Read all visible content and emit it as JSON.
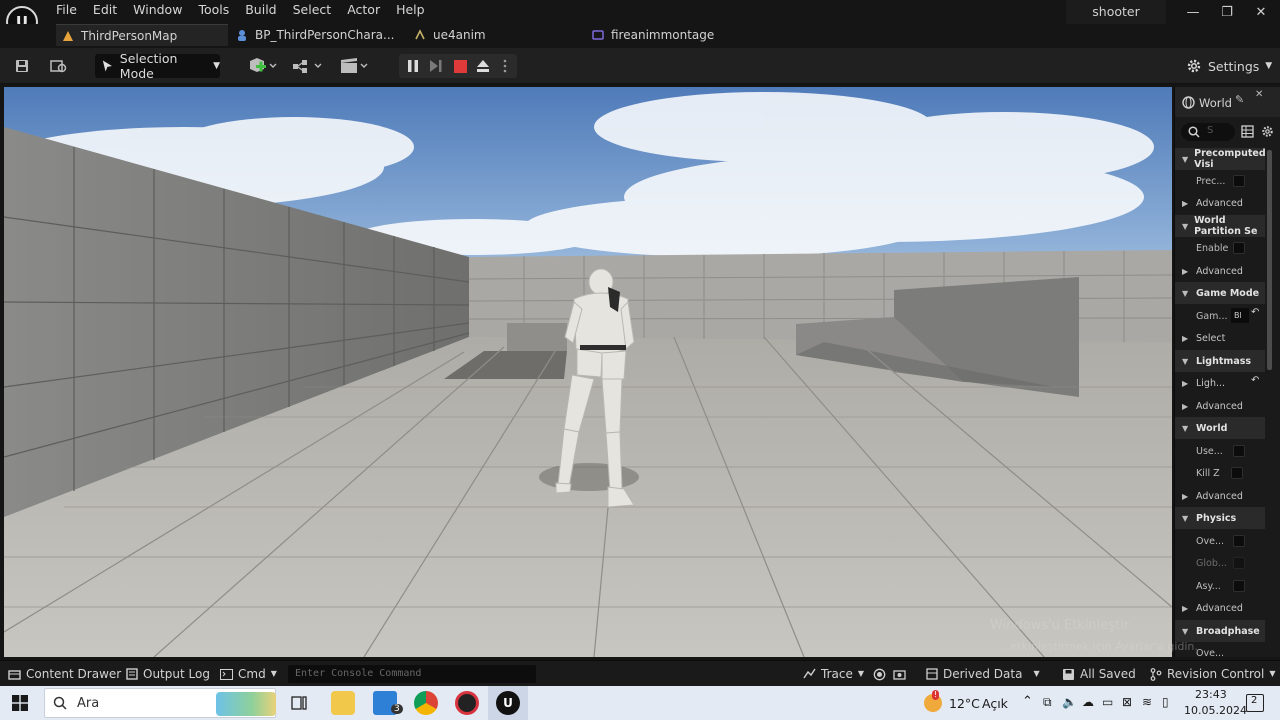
{
  "app": {
    "logo_letter": "U",
    "menu": [
      "File",
      "Edit",
      "Window",
      "Tools",
      "Build",
      "Select",
      "Actor",
      "Help"
    ],
    "project_name": "shooter",
    "window_controls": {
      "minimize": "—",
      "maximize": "❐",
      "close": "✕"
    }
  },
  "tabs": [
    {
      "label": "ThirdPersonMap",
      "active": true
    },
    {
      "label": "BP_ThirdPersonChara...",
      "active": false
    },
    {
      "label": "ue4anim",
      "active": false
    },
    {
      "label": "fireanimmontage",
      "active": false
    }
  ],
  "toolbar": {
    "mode_label": "Selection Mode",
    "settings_label": "Settings"
  },
  "details": {
    "tab_title": "World",
    "search_placeholder": "S",
    "rows": [
      {
        "kind": "header",
        "label": "Precomputed Visi"
      },
      {
        "kind": "prop",
        "label": "Prec..."
      },
      {
        "kind": "collapsed",
        "label": "Advanced"
      },
      {
        "kind": "header",
        "label": "World Partition Se"
      },
      {
        "kind": "prop",
        "label": "Enable"
      },
      {
        "kind": "collapsed",
        "label": "Advanced"
      },
      {
        "kind": "header",
        "label": "Game Mode"
      },
      {
        "kind": "prop",
        "label": "Gam...",
        "value": "Bl"
      },
      {
        "kind": "collapsed",
        "label": "Select"
      },
      {
        "kind": "header",
        "label": "Lightmass"
      },
      {
        "kind": "collapsed",
        "label": "Ligh..."
      },
      {
        "kind": "collapsed",
        "label": "Advanced"
      },
      {
        "kind": "header",
        "label": "World"
      },
      {
        "kind": "prop",
        "label": "Use..."
      },
      {
        "kind": "prop",
        "label": "Kill Z"
      },
      {
        "kind": "collapsed",
        "label": "Advanced"
      },
      {
        "kind": "header",
        "label": "Physics"
      },
      {
        "kind": "prop",
        "label": "Ove..."
      },
      {
        "kind": "prop",
        "label": "Glob...",
        "dim": true
      },
      {
        "kind": "prop",
        "label": "Asy..."
      },
      {
        "kind": "collapsed",
        "label": "Advanced"
      },
      {
        "kind": "header",
        "label": "Broadphase"
      },
      {
        "kind": "prop",
        "label": "Ove..."
      }
    ]
  },
  "bottom": {
    "content_drawer": "Content Drawer",
    "output_log": "Output Log",
    "cmd": "Cmd",
    "console_placeholder": "Enter Console Command",
    "trace": "Trace",
    "derived_data": "Derived Data",
    "all_saved": "All Saved",
    "revision_control": "Revision Control"
  },
  "watermark": {
    "line1": "Windows'u Etkinleştir",
    "line2": "...etkinleştirmek için Ayarlar'a gidin."
  },
  "taskbar": {
    "search_label": "Ara",
    "mail_badge": "3",
    "weather_badge": "!",
    "temperature": "12°C",
    "weather": "Açık",
    "time": "23:43",
    "date": "10.05.2024",
    "notifications": "2"
  },
  "colors": {
    "accent_orange": "#e8a33a",
    "stop_red": "#e03a3a",
    "sky_top": "#5b86c2",
    "floor": "#b9b7b1"
  }
}
